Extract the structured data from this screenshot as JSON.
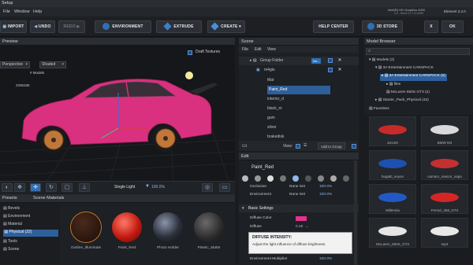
{
  "window": {
    "title": "Setup",
    "gpu_info": "Intel(R) HD Graphics 4000",
    "gpu_info_sub": "4.0 - Build 9.17.10.4459",
    "element_label": "Element 3.2.0"
  },
  "menu": {
    "items": [
      "File",
      "Window",
      "Help"
    ]
  },
  "toolbar": {
    "import": "IMPORT",
    "undo": "UNDO",
    "redo": "REDO",
    "environment": "ENVIRONMENT",
    "extrude": "EXTRUDE",
    "create": "CREATE",
    "help_center": "HELP CENTER",
    "store_3d": "3D STORE",
    "close": "X",
    "ok": "OK"
  },
  "preview": {
    "header": "Preview",
    "draft_textures": "Draft Textures",
    "camera_select": "Perspective",
    "shading_select": "Shaded",
    "models_label": "# Models",
    "poly_count": "2336165",
    "light_select": "Single Light",
    "light_pct": "100.0%"
  },
  "scene": {
    "header": "Scene",
    "menu": [
      "File",
      "Edit",
      "View"
    ],
    "group_folder": "Group Folder",
    "group_tag": "Nu...",
    "rows": [
      "m4gts",
      "Mat",
      "Paint_Red",
      "interior_d",
      "black_m",
      "gum",
      "silver",
      "brakedisk"
    ],
    "view_label": "View:",
    "add_to_group": "Add to Group"
  },
  "edit": {
    "header": "Edit",
    "material_name": "Paint_Red",
    "rows": [
      {
        "label": "Occlusion",
        "value": "None Set",
        "pct": "100.0%"
      },
      {
        "label": "Environment",
        "value": "None Set",
        "pct": "100.0%"
      }
    ],
    "basic_settings": "Basic Settings",
    "diffuse_color": "Diffuse Color",
    "diffuse": "Diffuse",
    "diffuse_value": "0.45",
    "tooltip_title": "DIFFUSE INTENSITY:",
    "tooltip_body": "Adjust the light influence of diffuse brightness.",
    "env_multiplier": "Environment Multiplier",
    "env_mult_pct": "100.0%",
    "swatch_color": "#e0338f"
  },
  "model_browser": {
    "header": "Model Browser",
    "tree": [
      {
        "label": "Models (2)"
      },
      {
        "label": "3A Entertainment CARSPACK"
      },
      {
        "label": "3A Entertainment CARSPACK (5)"
      },
      {
        "label": "files"
      },
      {
        "label": "McLaren 650S GT3 (2)"
      },
      {
        "label": "Starter_Pack_Physical (42)"
      },
      {
        "label": "Favorites"
      }
    ],
    "thumbs": [
      {
        "caption": "am150",
        "color": "#c82a2a"
      },
      {
        "caption": "BMW M4",
        "color": "#d9d9d9"
      },
      {
        "caption": "bugatti_veyon",
        "color": "#1f4fb0"
      },
      {
        "caption": "camaro_nascar_napa",
        "color": "#c23030"
      },
      {
        "caption": "Millennia",
        "color": "#2359c4"
      },
      {
        "caption": "Ferrari_458_GT2",
        "color": "#d42626"
      },
      {
        "caption": "McLaren_650S_GT3",
        "color": "#e5e5e5"
      },
      {
        "caption": "mp4",
        "color": "#e8e8e8"
      }
    ]
  },
  "presets": {
    "tab_presets": "Presets",
    "tab_scene_materials": "Scene Materials",
    "categories": [
      "Bevels",
      "Environment",
      "Material",
      "Physical (22)",
      "Tools",
      "Scene"
    ],
    "materials": [
      {
        "name": "Outline_Illuminate",
        "color": "#2a1a14"
      },
      {
        "name": "Paint_Red",
        "color": "#d62a1a"
      },
      {
        "name": "Photo Holder",
        "color": "#2a2f3a"
      },
      {
        "name": "Plastic_Matte",
        "color": "#3a3a3a"
      }
    ]
  },
  "colors": {
    "accent": "#2f6fb5",
    "selection": "#2f5f9a",
    "car_paint": "#d9307f"
  }
}
